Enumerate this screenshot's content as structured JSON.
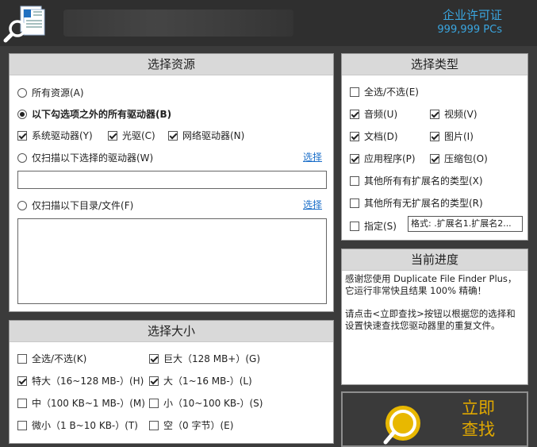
{
  "header": {
    "license_line1": "企业许可证",
    "license_line2": "999,999 PCs",
    "logo_icon": "document-search-icon"
  },
  "resources": {
    "title": "选择资源",
    "all": "所有资源(A)",
    "except_selected": "以下勾选项之外的所有驱动器(B)",
    "system_drive": "系统驱动器(Y)",
    "optical": "光驱(C)",
    "network": "网络驱动器(N)",
    "only_selected_drives": "仅扫描以下选择的驱动器(W)",
    "select_link_1": "选择",
    "drives_value": "",
    "only_dirs": "仅扫描以下目录/文件(F)",
    "select_link_2": "选择",
    "dirs_value": ""
  },
  "types": {
    "title": "选择类型",
    "all": "全选/不选(E)",
    "audio": "音频(U)",
    "video": "视频(V)",
    "document": "文档(D)",
    "image": "图片(I)",
    "application": "应用程序(P)",
    "archive": "压缩包(O)",
    "other_with_ext": "其他所有有扩展名的类型(X)",
    "other_without_ext": "其他所有无扩展名的类型(R)",
    "specify": "指定(S)",
    "format_value": "格式: .扩展名1.扩展名2..."
  },
  "progress": {
    "title": "当前进度",
    "line1": "感谢您使用 Duplicate File Finder Plus，它运行非常快且结果 100% 精确！",
    "line2": "请点击<立即查找>按钮以根据您的选择和设置快速查找您驱动器里的重复文件。"
  },
  "sizes": {
    "title": "选择大小",
    "all": "全选/不选(K)",
    "huge": "巨大（128 MB+）(G)",
    "very_large": "特大（16~128 MB-）(H)",
    "large": "大（1~16 MB-）(L)",
    "medium": "中（100 KB~1 MB-）(M)",
    "small": "小（10~100 KB-）(S)",
    "tiny": "微小（1 B~10 KB-）(T)",
    "empty": "空（0 字节）(E)"
  },
  "scan_button": {
    "line1": "立即",
    "line2": "查找",
    "icon": "magnifier-icon"
  },
  "colors": {
    "accent_blue": "#3aa6e0",
    "scan_gold": "#e0a800",
    "background": "#3b3b3b"
  }
}
